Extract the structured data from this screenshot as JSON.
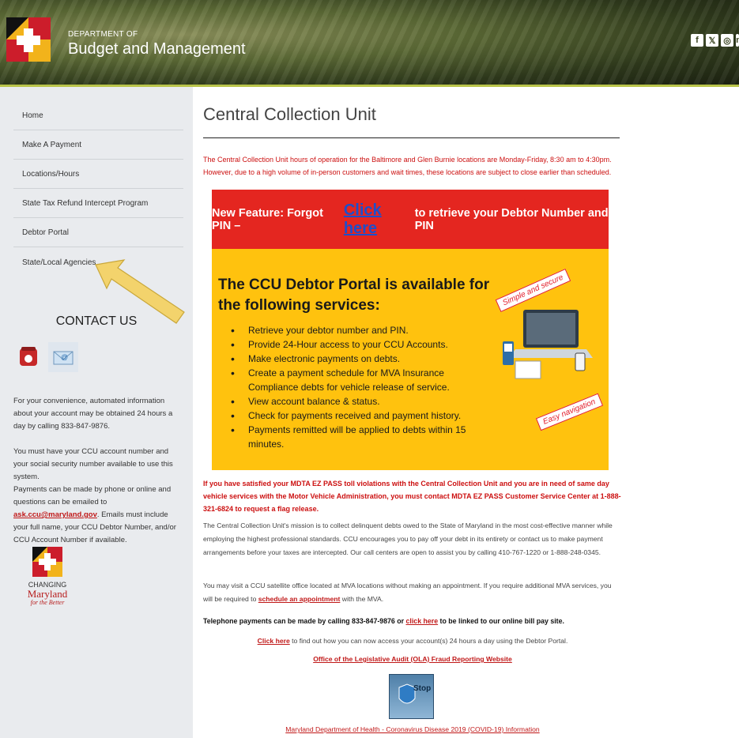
{
  "header": {
    "dept_small": "DEPARTMENT OF",
    "dept_big": "Budget and Management",
    "social_icons": [
      "facebook-icon",
      "x-icon",
      "instagram-icon",
      "linkedin-icon"
    ],
    "social_glyphs": [
      "f",
      "𝕏",
      "◎",
      "in"
    ]
  },
  "sidebar": {
    "items": [
      {
        "label": "Home"
      },
      {
        "label": "Make A Payment"
      },
      {
        "label": "Locations/Hours"
      },
      {
        "label": "State Tax Refund Intercept Program"
      },
      {
        "label": "Debtor Portal"
      },
      {
        "label": "State/Local Agencies"
      }
    ],
    "contact_title": "CONTACT US",
    "para1": "For your convenience, automated information about your account may be obtained 24 hours a day by calling 833-847-9876.",
    "para2": "You must have your CCU account number and your social security number available to use this system.",
    "para3_a": "Payments can be made by phone or online and questions can be emailed to ",
    "para3_link": "ask.ccu@maryland.gov",
    "para3_b": ". Emails must include your full name, your CCU Debtor Number, and/or CCU Account Number if available.",
    "logo_line1": "CHANGING",
    "logo_line2": "Maryland",
    "logo_line3": "for the Better"
  },
  "main": {
    "title": "Central Collection Unit",
    "hours_notice": "The Central Collection Unit hours of operation for the Baltimore and Glen Burnie locations are Monday-Friday, 8:30 am to 4:30pm. However, due to a high volume of in-person customers and wait times, these locations are subject to close earlier than scheduled.",
    "banner": {
      "pre": "New Feature: Forgot PIN – ",
      "cta": "Click here",
      "post": " to retrieve your Debtor Number and PIN",
      "portal_title": "The CCU Debtor Portal is available for the following services:",
      "services": [
        "Retrieve your debtor number and PIN.",
        "Provide 24-Hour access to your CCU Accounts.",
        "Make electronic payments on debts.",
        "Create a payment schedule for MVA Insurance Compliance debts for vehicle release of service.",
        "View account balance & status.",
        "Check for payments received and payment history.",
        "Payments remitted will be applied to debts within 15 minutes."
      ],
      "tag1": "Simple and secure",
      "tag2": "Easy navigation"
    },
    "ezpass_notice": "If you have satisfied your MDTA EZ PASS toll violations with the Central Collection Unit and you are in need of same day vehicle services with the Motor Vehicle Administration, you must contact MDTA EZ PASS Customer Service Center at 1-888-321-6824 to request a flag release.",
    "mission": "The Central Collection Unit's mission is to collect delinquent debts owed to the State of Maryland in the most cost-effective manner while employing the highest professional standards. CCU encourages you to pay off your debt in its entirety or contact us to make payment arrangements before your taxes are intercepted. Our call centers are open to assist you by calling 410-767-1220 or 1-888-248-0345.",
    "mva_a": "You may visit a CCU satellite office located at MVA locations without making an appointment. If you require additional MVA services, you will be required to ",
    "mva_link": "schedule an appointment",
    "mva_b": " with the MVA.",
    "phone_a": "Telephone payments can be made by calling 833-847-9876 or ",
    "phone_link": "click here",
    "phone_b": " to be linked to our online bill pay site.",
    "portal_link": "Click here",
    "portal_rest": " to find out how you can now access your account(s) 24 hours a day using the Debtor Portal.",
    "ola_link": "Office of the Legislative Audit (OLA) Fraud Reporting Website",
    "stop_fraud": "Stop fraud",
    "covid_link": "Maryland Department of Health - Coronavirus Disease 2019 (COVID-19) Information"
  },
  "colors": {
    "accent_red": "#cc1010",
    "banner_red": "#e42620",
    "banner_yellow": "#ffc20e",
    "sidebar_bg": "#e9ebee",
    "arrow": "#f3d36c"
  }
}
